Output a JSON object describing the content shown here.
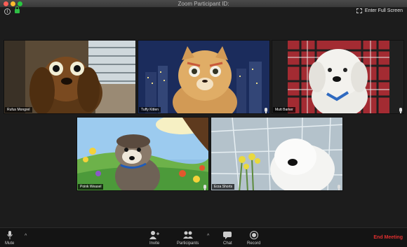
{
  "window": {
    "title": "Zoom Participant ID:"
  },
  "topbar": {
    "fullscreen_label": "Enter Full Screen"
  },
  "participants": [
    {
      "name": "Rufus Mongrel"
    },
    {
      "name": "Tuffy Kitten"
    },
    {
      "name": "Mutt Barker"
    },
    {
      "name": "Poink Weasel"
    },
    {
      "name": "Erza Shorts"
    }
  ],
  "toolbar": {
    "mute": "Mute",
    "invite": "Invite",
    "participants": "Participants",
    "chat": "Chat",
    "record": "Record",
    "end": "End Meeting"
  },
  "colors": {
    "end_meeting": "#e02f2f",
    "background": "#1c1c1c"
  }
}
